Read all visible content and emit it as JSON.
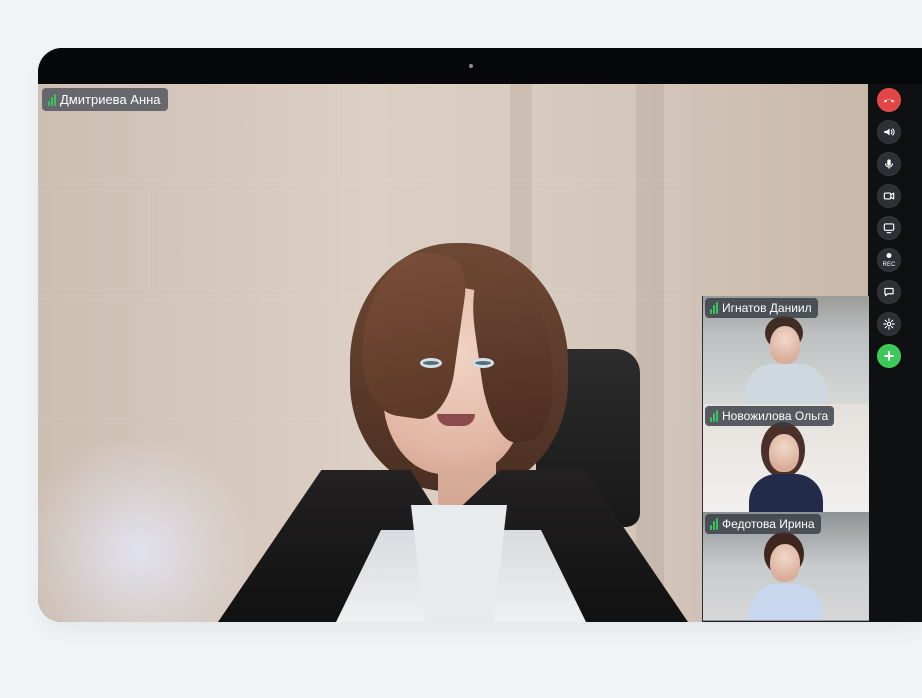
{
  "main_participant": {
    "name": "Дмитриева Анна"
  },
  "participants": [
    {
      "name": "Игнатов Даниил"
    },
    {
      "name": "Новожилова Ольга"
    },
    {
      "name": "Федотова Ирина"
    }
  ],
  "toolbar": {
    "rec_label": "REC",
    "add_symbol": "+"
  },
  "colors": {
    "hangup": "#e24646",
    "add": "#3dc95a",
    "active_mic": "#39c55e",
    "toolbar_button": "#2d2f35"
  },
  "icons": [
    "phone-hangup-icon",
    "speaker-icon",
    "microphone-icon",
    "camera-icon",
    "screen-share-icon",
    "record-icon",
    "chat-icon",
    "settings-icon",
    "add-icon"
  ]
}
